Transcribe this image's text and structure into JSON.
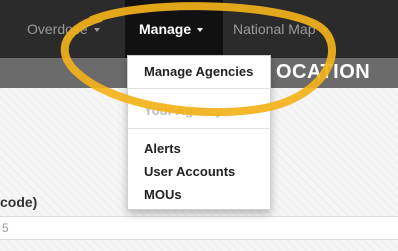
{
  "navbar": {
    "items": [
      {
        "label": "Overdose"
      },
      {
        "label": "Manage"
      },
      {
        "label": "National Map"
      }
    ]
  },
  "title_band": {
    "text": "OCATION"
  },
  "dropdown": {
    "items": [
      {
        "label": "Manage Agencies"
      },
      {
        "label": "Your Agency"
      },
      {
        "label": "Alerts"
      },
      {
        "label": "User Accounts"
      },
      {
        "label": "MOUs"
      }
    ]
  },
  "form": {
    "label": "code)",
    "value": "5"
  },
  "colors": {
    "navbar": "#2b2b2b",
    "active_nav": "#111111",
    "title_band": "#6b6b6b",
    "annotation": "#f2b21a"
  },
  "icons": {
    "caret": "caret-down-icon"
  }
}
